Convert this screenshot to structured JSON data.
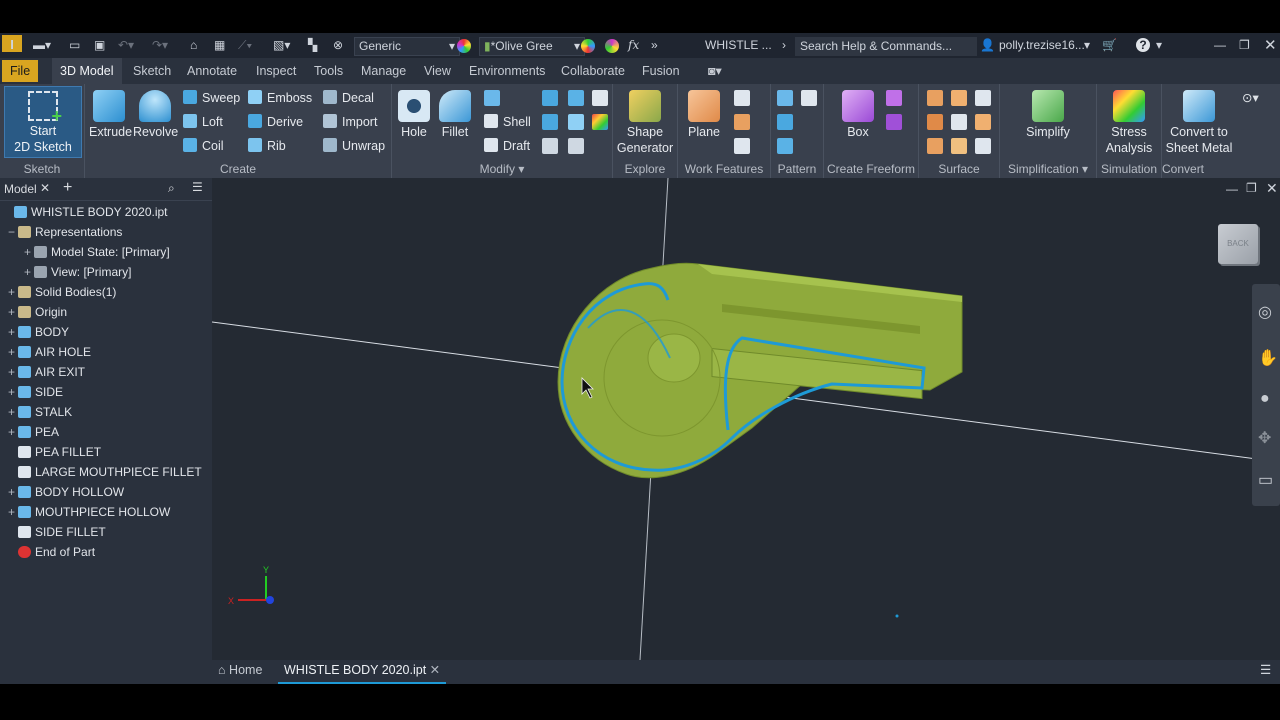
{
  "qab": {
    "app_logo": "I",
    "appearance_combo": "Generic",
    "material_combo": "*Olive Gree",
    "doc_title": "WHISTLE ...",
    "search_placeholder": "Search Help & Commands...",
    "user": "polly.trezise16..."
  },
  "tabs": [
    "File",
    "3D Model",
    "Sketch",
    "Annotate",
    "Inspect",
    "Tools",
    "Manage",
    "View",
    "Environments",
    "Collaborate",
    "Fusion"
  ],
  "ribbon": {
    "sketch": {
      "label": "Sketch",
      "start_line1": "Start",
      "start_line2": "2D Sketch"
    },
    "create": {
      "label": "Create",
      "extrude": "Extrude",
      "revolve": "Revolve",
      "sweep": "Sweep",
      "loft": "Loft",
      "coil": "Coil",
      "emboss": "Emboss",
      "derive": "Derive",
      "rib": "Rib",
      "decal": "Decal",
      "import": "Import",
      "unwrap": "Unwrap"
    },
    "modify": {
      "label": "Modify",
      "hole": "Hole",
      "fillet": "Fillet",
      "shell": "Shell",
      "draft": "Draft"
    },
    "explore": {
      "label": "Explore",
      "shape_line1": "Shape",
      "shape_line2": "Generator"
    },
    "work": {
      "label": "Work Features",
      "plane": "Plane"
    },
    "pattern": {
      "label": "Pattern"
    },
    "freeform": {
      "label": "Create Freeform",
      "box": "Box"
    },
    "surface": {
      "label": "Surface"
    },
    "simplification": {
      "label": "Simplification",
      "simplify": "Simplify"
    },
    "simulation": {
      "label": "Simulation",
      "stress_line1": "Stress",
      "stress_line2": "Analysis"
    },
    "convert": {
      "label": "Convert",
      "sheet_line1": "Convert to",
      "sheet_line2": "Sheet Metal"
    }
  },
  "browser": {
    "title": "Model",
    "nodes": [
      {
        "label": "WHISTLE BODY 2020.ipt",
        "indent": 0,
        "pm": "",
        "icon": "part-icon"
      },
      {
        "label": "Representations",
        "indent": 1,
        "pm": "−",
        "icon": "folder-icon"
      },
      {
        "label": "Model State: [Primary]",
        "indent": 2,
        "pm": "+",
        "icon": "model-state-icon"
      },
      {
        "label": "View: [Primary]",
        "indent": 2,
        "pm": "+",
        "icon": "view-icon"
      },
      {
        "label": "Solid Bodies(1)",
        "indent": 1,
        "pm": "+",
        "icon": "folder-icon"
      },
      {
        "label": "Origin",
        "indent": 1,
        "pm": "+",
        "icon": "folder-icon"
      },
      {
        "label": "BODY",
        "indent": 1,
        "pm": "+",
        "icon": "feature-icon"
      },
      {
        "label": "AIR HOLE",
        "indent": 1,
        "pm": "+",
        "icon": "feature-icon"
      },
      {
        "label": "AIR EXIT",
        "indent": 1,
        "pm": "+",
        "icon": "feature-icon"
      },
      {
        "label": "SIDE",
        "indent": 1,
        "pm": "+",
        "icon": "feature-icon"
      },
      {
        "label": "STALK",
        "indent": 1,
        "pm": "+",
        "icon": "feature-icon"
      },
      {
        "label": "PEA",
        "indent": 1,
        "pm": "+",
        "icon": "feature-icon"
      },
      {
        "label": "PEA FILLET",
        "indent": 1,
        "pm": "",
        "icon": "fillet-icon"
      },
      {
        "label": "LARGE MOUTHPIECE FILLET",
        "indent": 1,
        "pm": "",
        "icon": "fillet-icon"
      },
      {
        "label": "BODY HOLLOW",
        "indent": 1,
        "pm": "+",
        "icon": "feature-icon"
      },
      {
        "label": "MOUTHPIECE HOLLOW",
        "indent": 1,
        "pm": "+",
        "icon": "feature-icon"
      },
      {
        "label": "SIDE FILLET",
        "indent": 1,
        "pm": "",
        "icon": "fillet-icon"
      },
      {
        "label": "End of Part",
        "indent": 1,
        "pm": "",
        "icon": "end-of-part-icon"
      }
    ]
  },
  "viewcube": {
    "face": "BACK"
  },
  "doctabs": {
    "home": "Home",
    "active": "WHISTLE BODY 2020.ipt"
  },
  "colors": {
    "accent": "#d9a520",
    "highlight": "#1e9ad6",
    "model": "#8faa3c"
  }
}
